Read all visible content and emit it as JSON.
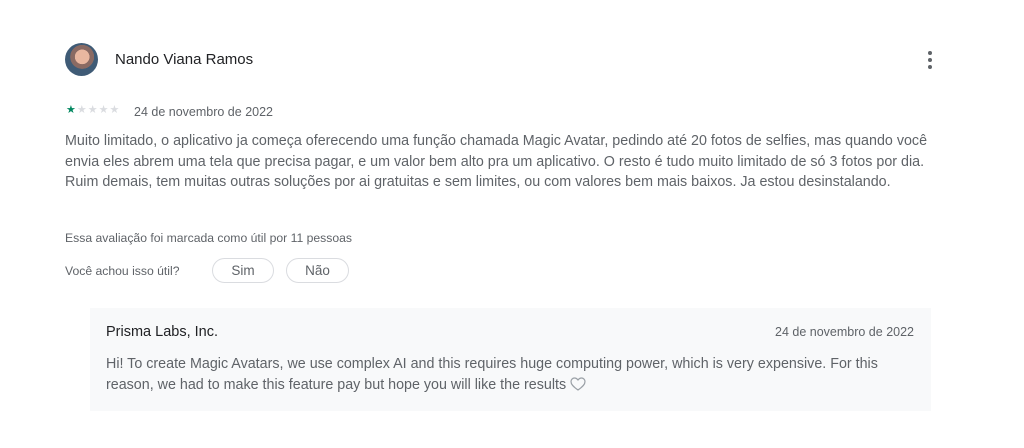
{
  "review": {
    "author": "Nando Viana Ramos",
    "rating": 1,
    "max_rating": 5,
    "date": "24 de novembro de 2022",
    "text": "Muito limitado, o aplicativo ja começa oferecendo uma função chamada Magic Avatar, pedindo até 20 fotos de selfies, mas quando você envia eles abrem uma tela que precisa pagar, e um valor bem alto pra um aplicativo. O resto é tudo muito limitado de só 3 fotos por dia. Ruim demais, tem muitas outras soluções por ai gratuitas e sem limites, ou com valores bem mais baixos. Ja estou desinstalando.",
    "helpful_count_text": "Essa avaliação foi marcada como útil por 11 pessoas",
    "helpful_question": "Você achou isso útil?",
    "yes_label": "Sim",
    "no_label": "Não"
  },
  "developer_reply": {
    "author": "Prisma Labs, Inc.",
    "date": "24 de novembro de 2022",
    "text": "Hi! To create Magic Avatars, we use complex AI and this requires huge computing power, which is very expensive. For this reason, we had to make this feature pay but hope you will like the results",
    "trailing_icon": "heart-outline-icon"
  },
  "icons": {
    "menu": "more-vert-icon",
    "star": "star-icon"
  },
  "colors": {
    "star_filled": "#01875f",
    "star_empty": "#dadce0",
    "reply_background": "#f8f9fa",
    "text_secondary": "#5f6368"
  }
}
